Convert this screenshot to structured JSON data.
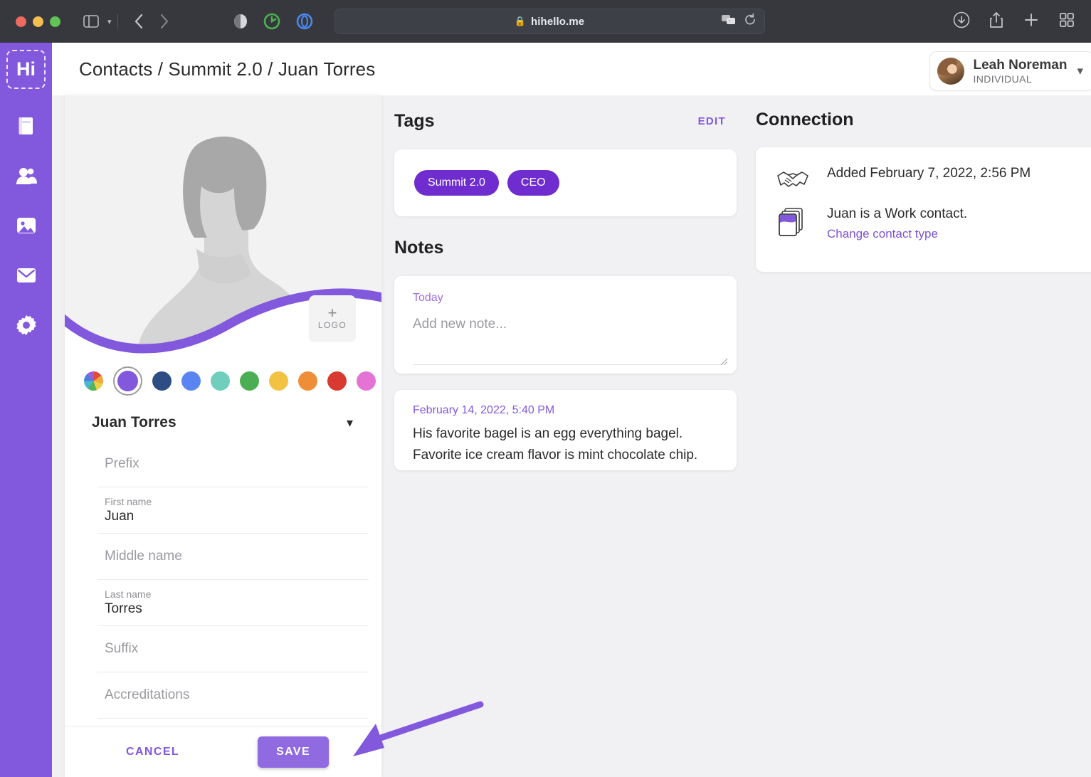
{
  "browser": {
    "url": "hihello.me",
    "lock_icon": "lock-icon",
    "traffic_lights": [
      "close",
      "minimize",
      "maximize"
    ],
    "controls": {
      "sidebar_toggle": "sidebar-toggle-icon",
      "sidebar_caret": "chevron-down-icon",
      "back": "chevron-left-icon",
      "forward": "chevron-right-icon",
      "reader": "reader-icon",
      "extension_green": "extension-green-icon",
      "extension_blue": "extension-blue-icon",
      "translate": "translate-icon",
      "reload": "reload-icon",
      "downloads": "download-icon",
      "share": "share-icon",
      "new_tab": "plus-icon",
      "tab_overview": "tab-overview-icon"
    }
  },
  "rail": {
    "logo": "Hi",
    "items": [
      {
        "name": "cards",
        "icon": "cards-icon"
      },
      {
        "name": "contacts",
        "icon": "contacts-icon"
      },
      {
        "name": "gallery",
        "icon": "photo-icon"
      },
      {
        "name": "mail",
        "icon": "mail-icon"
      },
      {
        "name": "settings",
        "icon": "gear-icon"
      }
    ]
  },
  "header": {
    "breadcrumb": "Contacts / Summit 2.0 / Juan Torres",
    "account": {
      "name": "Leah Noreman",
      "role": "INDIVIDUAL",
      "caret": "chevron-down-icon"
    }
  },
  "editor": {
    "logo_button": {
      "plus": "+",
      "label": "LOGO"
    },
    "swatches": [
      {
        "name": "multicolor",
        "hex": "multicolor",
        "selected": false
      },
      {
        "name": "purple",
        "hex": "#8258dd",
        "selected": true
      },
      {
        "name": "navy",
        "hex": "#2f4d85",
        "selected": false
      },
      {
        "name": "blue",
        "hex": "#5a84ef",
        "selected": false
      },
      {
        "name": "mint",
        "hex": "#6fcfbc",
        "selected": false
      },
      {
        "name": "green",
        "hex": "#4cae54",
        "selected": false
      },
      {
        "name": "yellow",
        "hex": "#f2c343",
        "selected": false
      },
      {
        "name": "orange",
        "hex": "#ef8e38",
        "selected": false
      },
      {
        "name": "red",
        "hex": "#d93a2f",
        "selected": false
      },
      {
        "name": "pink",
        "hex": "#e374d6",
        "selected": false
      }
    ],
    "name_section_label": "Juan Torres",
    "name_section_caret": "chevron-down-icon",
    "fields": [
      {
        "label": "Prefix",
        "value": "",
        "placeholder": "Prefix"
      },
      {
        "label": "First name",
        "value": "Juan",
        "placeholder": "First name"
      },
      {
        "label": "Middle name",
        "value": "",
        "placeholder": "Middle name"
      },
      {
        "label": "Last name",
        "value": "Torres",
        "placeholder": "Last name"
      },
      {
        "label": "Suffix",
        "value": "",
        "placeholder": "Suffix"
      },
      {
        "label": "Accreditations",
        "value": "",
        "placeholder": "Accreditations"
      }
    ],
    "cancel_label": "CANCEL",
    "save_label": "SAVE"
  },
  "tags": {
    "title": "Tags",
    "edit_label": "EDIT",
    "pills": [
      "Summit 2.0",
      "CEO"
    ]
  },
  "notes": {
    "title": "Notes",
    "new_note": {
      "date": "Today",
      "placeholder": "Add new note..."
    },
    "items": [
      {
        "date": "February 14, 2022, 5:40 PM",
        "line1": "His favorite bagel is an egg everything bagel.",
        "line2": "Favorite ice cream flavor is mint chocolate chip."
      }
    ]
  },
  "connection": {
    "title": "Connection",
    "added_text": "Added February 7, 2022, 2:56 PM",
    "added_icon": "handshake-icon",
    "contact_type_text": "Juan is a Work contact.",
    "contact_type_icon": "cards-stack-icon",
    "change_link": "Change contact type"
  },
  "colors": {
    "accent": "#8258dd",
    "tag": "#6f2dd0",
    "chrome": "#36383e",
    "app_bg": "#f1f1f3"
  }
}
